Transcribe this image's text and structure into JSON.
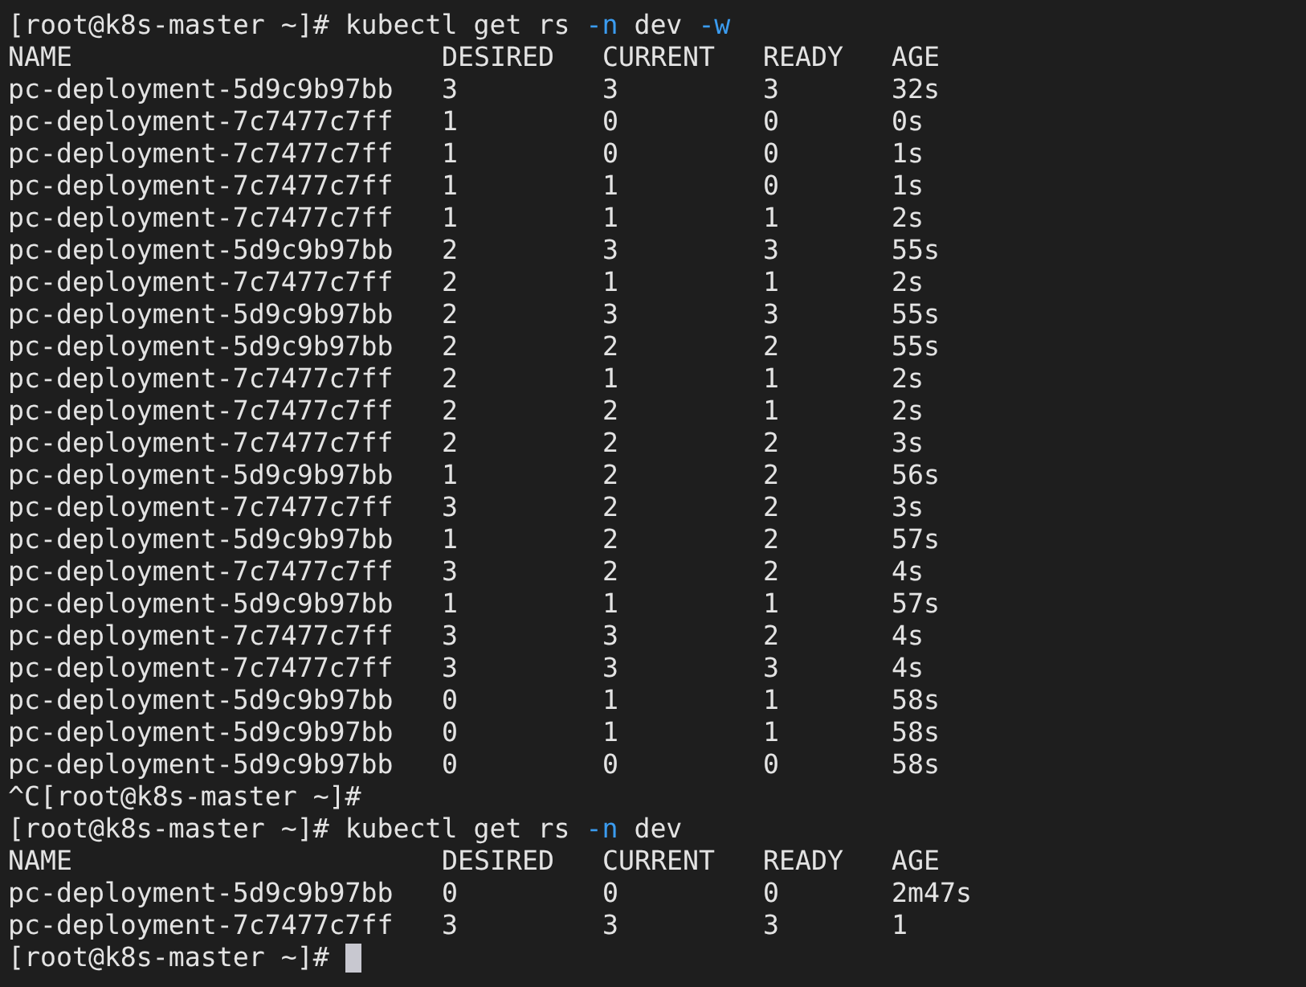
{
  "lines": [
    {
      "kind": "prompt",
      "prompt": "[root@k8s-master ~]#",
      "tokens": [
        {
          "text": "kubectl",
          "flag": false
        },
        {
          "text": "get",
          "flag": false
        },
        {
          "text": "rs",
          "flag": false
        },
        {
          "text": "-n",
          "flag": true
        },
        {
          "text": "dev",
          "flag": false
        },
        {
          "text": "-w",
          "flag": true
        }
      ]
    },
    {
      "kind": "table",
      "cells": [
        "NAME",
        "DESIRED",
        "CURRENT",
        "READY",
        "AGE"
      ]
    },
    {
      "kind": "table",
      "cells": [
        "pc-deployment-5d9c9b97bb",
        "3",
        "3",
        "3",
        "32s"
      ]
    },
    {
      "kind": "table",
      "cells": [
        "pc-deployment-7c7477c7ff",
        "1",
        "0",
        "0",
        "0s"
      ]
    },
    {
      "kind": "table",
      "cells": [
        "pc-deployment-7c7477c7ff",
        "1",
        "0",
        "0",
        "1s"
      ]
    },
    {
      "kind": "table",
      "cells": [
        "pc-deployment-7c7477c7ff",
        "1",
        "1",
        "0",
        "1s"
      ]
    },
    {
      "kind": "table",
      "cells": [
        "pc-deployment-7c7477c7ff",
        "1",
        "1",
        "1",
        "2s"
      ]
    },
    {
      "kind": "table",
      "cells": [
        "pc-deployment-5d9c9b97bb",
        "2",
        "3",
        "3",
        "55s"
      ]
    },
    {
      "kind": "table",
      "cells": [
        "pc-deployment-7c7477c7ff",
        "2",
        "1",
        "1",
        "2s"
      ]
    },
    {
      "kind": "table",
      "cells": [
        "pc-deployment-5d9c9b97bb",
        "2",
        "3",
        "3",
        "55s"
      ]
    },
    {
      "kind": "table",
      "cells": [
        "pc-deployment-5d9c9b97bb",
        "2",
        "2",
        "2",
        "55s"
      ]
    },
    {
      "kind": "table",
      "cells": [
        "pc-deployment-7c7477c7ff",
        "2",
        "1",
        "1",
        "2s"
      ]
    },
    {
      "kind": "table",
      "cells": [
        "pc-deployment-7c7477c7ff",
        "2",
        "2",
        "1",
        "2s"
      ]
    },
    {
      "kind": "table",
      "cells": [
        "pc-deployment-7c7477c7ff",
        "2",
        "2",
        "2",
        "3s"
      ]
    },
    {
      "kind": "table",
      "cells": [
        "pc-deployment-5d9c9b97bb",
        "1",
        "2",
        "2",
        "56s"
      ]
    },
    {
      "kind": "table",
      "cells": [
        "pc-deployment-7c7477c7ff",
        "3",
        "2",
        "2",
        "3s"
      ]
    },
    {
      "kind": "table",
      "cells": [
        "pc-deployment-5d9c9b97bb",
        "1",
        "2",
        "2",
        "57s"
      ]
    },
    {
      "kind": "table",
      "cells": [
        "pc-deployment-7c7477c7ff",
        "3",
        "2",
        "2",
        "4s"
      ]
    },
    {
      "kind": "table",
      "cells": [
        "pc-deployment-5d9c9b97bb",
        "1",
        "1",
        "1",
        "57s"
      ]
    },
    {
      "kind": "table",
      "cells": [
        "pc-deployment-7c7477c7ff",
        "3",
        "3",
        "2",
        "4s"
      ]
    },
    {
      "kind": "table",
      "cells": [
        "pc-deployment-7c7477c7ff",
        "3",
        "3",
        "3",
        "4s"
      ]
    },
    {
      "kind": "table",
      "cells": [
        "pc-deployment-5d9c9b97bb",
        "0",
        "1",
        "1",
        "58s"
      ]
    },
    {
      "kind": "table",
      "cells": [
        "pc-deployment-5d9c9b97bb",
        "0",
        "1",
        "1",
        "58s"
      ]
    },
    {
      "kind": "table",
      "cells": [
        "pc-deployment-5d9c9b97bb",
        "0",
        "0",
        "0",
        "58s"
      ]
    },
    {
      "kind": "prompt",
      "prompt": "^C[root@k8s-master ~]#"
    },
    {
      "kind": "prompt",
      "prompt": "[root@k8s-master ~]#",
      "tokens": [
        {
          "text": "kubectl",
          "flag": false
        },
        {
          "text": "get",
          "flag": false
        },
        {
          "text": "rs",
          "flag": false
        },
        {
          "text": "-n",
          "flag": true
        },
        {
          "text": "dev",
          "flag": false
        }
      ]
    },
    {
      "kind": "table",
      "cells": [
        "NAME",
        "DESIRED",
        "CURRENT",
        "READY",
        "AGE"
      ]
    },
    {
      "kind": "table",
      "cells": [
        "pc-deployment-5d9c9b97bb",
        "0",
        "0",
        "0",
        "2m47s"
      ]
    },
    {
      "kind": "table",
      "cells": [
        "pc-deployment-7c7477c7ff",
        "3",
        "3",
        "3",
        "1"
      ]
    },
    {
      "kind": "prompt",
      "prompt": "[root@k8s-master ~]#",
      "cursor": true
    }
  ]
}
